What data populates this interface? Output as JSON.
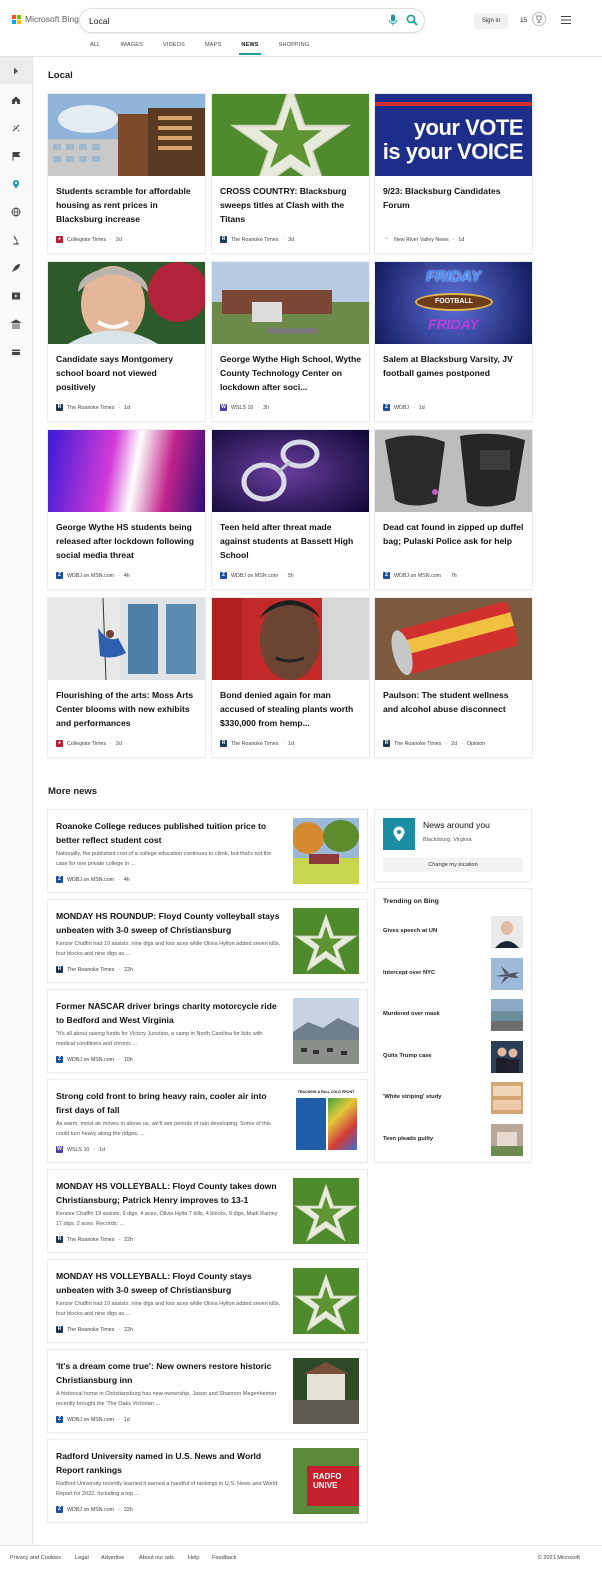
{
  "header": {
    "brand": "Microsoft Bing",
    "query": "Local",
    "sign_in": "Sign in",
    "points": "15",
    "tabs": [
      {
        "label": "ALL",
        "active": false
      },
      {
        "label": "IMAGES",
        "active": false
      },
      {
        "label": "VIDEOS",
        "active": false
      },
      {
        "label": "MAPS",
        "active": false
      },
      {
        "label": "NEWS",
        "active": true
      },
      {
        "label": "SHOPPING",
        "active": false
      }
    ]
  },
  "colors": {
    "accent": "#1a9ca0",
    "location_tile": "#1b8ea5",
    "brand_red": "#f25022",
    "brand_green": "#7fba00",
    "brand_blue": "#00a4ef",
    "brand_yellow": "#ffb900"
  },
  "sidebar_icons": [
    "expand-chevron-icon",
    "home-icon",
    "sports-icon",
    "flag-icon",
    "location-pin-icon",
    "globe-icon",
    "science-icon",
    "rocket-icon",
    "video-icon",
    "bank-icon",
    "payment-card-icon"
  ],
  "local": {
    "heading": "Local",
    "cards": [
      {
        "title": "Students scramble for affordable housing as rent prices in Blacksburg increase",
        "source": "Collegiate Times",
        "age": "2d",
        "extra": "",
        "image": "apartment-building-image"
      },
      {
        "title": "CROSS COUNTRY: Blacksburg sweeps titles at Clash with the Titans",
        "source": "The Roanoke Times",
        "age": "3d",
        "extra": "",
        "image": "grass-star-image"
      },
      {
        "title": "9/23: Blacksburg Candidates Forum",
        "source": "New River Valley News",
        "age": "1d",
        "extra": "",
        "image": "vote-voice-image",
        "img_text_1": "your VOTE",
        "img_text_2": "is your VOICE"
      },
      {
        "title": "Candidate says Montgomery school board not viewed positively",
        "source": "The Roanoke Times",
        "age": "1d",
        "extra": "",
        "image": "smiling-woman-image"
      },
      {
        "title": "George Wythe High School, Wythe County Technology Center on lockdown after soci...",
        "source": "WSLS 10",
        "age": "3h",
        "extra": "",
        "image": "school-building-image"
      },
      {
        "title": "Salem at Blacksburg Varsity, JV football games postponed",
        "source": "WDBJ",
        "age": "1d",
        "extra": "",
        "image": "friday-football-image",
        "img_text_1": "FRIDAY",
        "img_text_2": "FOOTBALL"
      },
      {
        "title": "George Wythe HS students being released after lockdown following social media threat",
        "source": "WDBJ on MSN.com",
        "age": "4h",
        "extra": "",
        "image": "police-lights-image"
      },
      {
        "title": "Teen held after threat made against students at Bassett High School",
        "source": "WDBJ on MSN.com",
        "age": "5h",
        "extra": "",
        "image": "handcuffs-image"
      },
      {
        "title": "Dead cat found in zipped up duffel bag; Pulaski Police ask for help",
        "source": "WDBJ on MSN.com",
        "age": "7h",
        "extra": "",
        "image": "duffel-bags-image"
      },
      {
        "title": "Flourishing of the arts: Moss Arts Center blooms with new exhibits and performances",
        "source": "Collegiate Times",
        "age": "2d",
        "extra": "",
        "image": "aerial-dancer-image"
      },
      {
        "title": "Bond denied again for man accused of stealing plants worth $330,000 from hemp...",
        "source": "The Roanoke Times",
        "age": "1d",
        "extra": "",
        "image": "mugshot-image"
      },
      {
        "title": "Paulson: The student wellness and alcohol abuse disconnect",
        "source": "The Roanoke Times",
        "age": "2d",
        "extra": "Opinion",
        "image": "beer-can-image"
      }
    ]
  },
  "more_news": {
    "heading": "More news",
    "items": [
      {
        "title": "Roanoke College reduces published tuition price to better reflect student cost",
        "desc": "Nationally, the published cost of a college education continues to climb, but that's not the case for one private college in ...",
        "source": "WDBJ on MSN.com",
        "age": "4h",
        "image": "college-sign-image"
      },
      {
        "title": "MONDAY HS ROUNDUP: Floyd County volleyball stays unbeaten with 3-0 sweep of Christiansburg",
        "desc": "Kenzie Chaffin had 19 assists, nine digs and four aces while Olivia Hylton added seven kills, four blocks and nine digs as ...",
        "source": "The Roanoke Times",
        "age": "22h",
        "image": "grass-star-image"
      },
      {
        "title": "Former NASCAR driver brings charity motorcycle ride to Bedford and West Virginia",
        "desc": "\"It's all about raising funds for Victory Junction, a camp in North Carolina for kids with medical conditions and chronic ...",
        "source": "WDBJ on MSN.com",
        "age": "10h",
        "image": "motorcycles-mountains-image"
      },
      {
        "title": "Strong cold front to bring heavy rain, cooler air into first days of fall",
        "desc": "As warm, moist air moves in above us, we'll see periods of rain developing. Some of this could turn heavy along the ridges, ...",
        "source": "WSLS 10",
        "age": "1d",
        "image": "weather-map-image",
        "img_text_1": "TRACKING A FALL COLD FRONT"
      },
      {
        "title": "MONDAY HS VOLLEYBALL: Floyd County takes down Christiansburg; Patrick Henry improves to 13-1",
        "desc": "Kenzee Chaffin 19 assists, 9 digs, 4 aces, Olivia Hylto 7 kills, 4 blocks, 9 digs, Madi Ramey 17 digs, 2 aces. Records: ...",
        "source": "The Roanoke Times",
        "age": "22h",
        "image": "grass-star-image"
      },
      {
        "title": "MONDAY HS VOLLEYBALL: Floyd County stays unbeaten with 3-0 sweep of Christiansburg",
        "desc": "Kenzie Chaffin had 19 assists, nine digs and four aces while Olivia Hylton added seven kills, four blocks and nine digs as ...",
        "source": "The Roanoke Times",
        "age": "22h",
        "image": "grass-star-image"
      },
      {
        "title": "'It's a dream come true': New owners restore historic Christiansburg inn",
        "desc": "A historical home in Christiansburg has new ownership. Jason and Shannon Magenheimer recently brought the 'The Oaks Victorian ...",
        "source": "WDBJ on MSN.com",
        "age": "1d",
        "image": "historic-inn-image"
      },
      {
        "title": "Radford University named in U.S. News and World Report rankings",
        "desc": "Radford University recently learned it earned a handful of rankings in U.S. News and World Report for 2022. Including a top ...",
        "source": "WDBJ on MSN.com",
        "age": "22h",
        "image": "radford-sign-image",
        "img_text_1": "RADFO",
        "img_text_2": "UNIVE"
      }
    ]
  },
  "news_around": {
    "title": "News around you",
    "location": "Blacksburg, Virginia",
    "button": "Change my location"
  },
  "trending": {
    "heading": "Trending on Bing",
    "items": [
      {
        "label": "Gives speech at UN",
        "image": "politician-portrait-image"
      },
      {
        "label": "Intercept over NYC",
        "image": "fighter-jet-image"
      },
      {
        "label": "Murdered over mask",
        "image": "store-parking-image"
      },
      {
        "label": "Quits Trump case",
        "image": "two-men-image"
      },
      {
        "label": "'White striping' study",
        "image": "chicken-meat-image"
      },
      {
        "label": "Teen pleads guilty",
        "image": "courthouse-sign-image"
      }
    ]
  },
  "footer": {
    "links": [
      "Privacy and Cookies",
      "Legal",
      "Advertise",
      "About our ads",
      "Help",
      "Feedback"
    ],
    "copyright": "© 2021 Microsoft"
  }
}
